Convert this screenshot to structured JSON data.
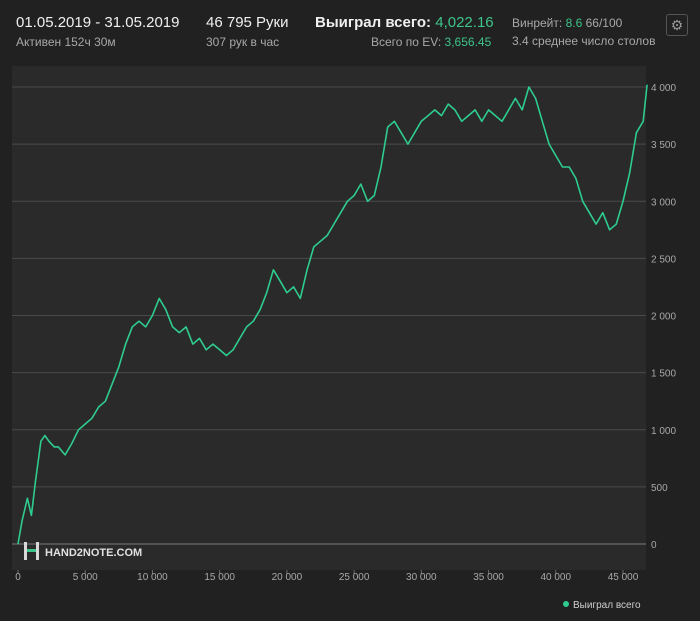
{
  "header": {
    "date_range": "01.05.2019 - 31.05.2019",
    "active": "Активен 152ч 30м",
    "hands": "46 795 Руки",
    "hands_per_hour": "307 рук в час",
    "won_label": "Выиграл всего:",
    "won_value": "4,022.16",
    "ev_label": "Всего по EV:",
    "ev_value": "3,656.45",
    "winrate_label": "Винрейт:",
    "winrate_value": "8.6",
    "winrate_suffix": "66/100",
    "tables": "3.4 среднее число столов"
  },
  "watermark": "HAND2NOTE.COM",
  "icons": {
    "settings": "gear-icon",
    "logo": "hand2note-logo-icon",
    "legend_dot": "dot-icon"
  },
  "colors": {
    "line": "#2ecc8f",
    "background": "#212121",
    "plot": "#2a2a2a",
    "accent": "#3ec48a"
  },
  "chart_data": {
    "type": "line",
    "title": "",
    "xlabel": "",
    "ylabel": "",
    "xlim": [
      0,
      46795
    ],
    "ylim": [
      -100,
      4100
    ],
    "x_ticks": [
      0,
      5000,
      10000,
      15000,
      20000,
      25000,
      30000,
      35000,
      40000,
      45000
    ],
    "x_tick_labels": [
      "0",
      "5 000",
      "10 000",
      "15 000",
      "20 000",
      "25 000",
      "30 000",
      "35 000",
      "40 000",
      "45 000"
    ],
    "y_ticks": [
      0,
      500,
      1000,
      1500,
      2000,
      2500,
      3000,
      3500,
      4000
    ],
    "y_tick_labels": [
      "0",
      "500",
      "1 000",
      "1 500",
      "2 000",
      "2 500",
      "3 000",
      "3 500",
      "4 000"
    ],
    "grid": true,
    "legend_position": "bottom-right",
    "series": [
      {
        "name": "Выиграл всего",
        "color": "#2ecc8f",
        "x": [
          0,
          300,
          700,
          1000,
          1300,
          1700,
          2000,
          2300,
          2700,
          3000,
          3500,
          4000,
          4500,
          5000,
          5500,
          6000,
          6500,
          7000,
          7500,
          8000,
          8500,
          9000,
          9500,
          10000,
          10500,
          11000,
          11500,
          12000,
          12500,
          13000,
          13500,
          14000,
          14500,
          15000,
          15500,
          16000,
          16500,
          17000,
          17500,
          18000,
          18500,
          19000,
          19500,
          20000,
          20500,
          21000,
          21500,
          22000,
          22500,
          23000,
          23500,
          24000,
          24500,
          25000,
          25500,
          26000,
          26500,
          27000,
          27500,
          28000,
          28500,
          29000,
          29500,
          30000,
          30500,
          31000,
          31500,
          32000,
          32500,
          33000,
          33500,
          34000,
          34500,
          35000,
          35500,
          36000,
          36500,
          37000,
          37500,
          38000,
          38500,
          39000,
          39500,
          40000,
          40500,
          41000,
          41500,
          42000,
          42500,
          43000,
          43500,
          44000,
          44500,
          45000,
          45500,
          46000,
          46500,
          46795
        ],
        "y": [
          0,
          200,
          400,
          250,
          550,
          900,
          950,
          900,
          850,
          850,
          780,
          880,
          1000,
          1050,
          1100,
          1200,
          1250,
          1400,
          1550,
          1750,
          1900,
          1950,
          1900,
          2000,
          2150,
          2050,
          1900,
          1850,
          1900,
          1750,
          1800,
          1700,
          1750,
          1700,
          1650,
          1700,
          1800,
          1900,
          1950,
          2050,
          2200,
          2400,
          2300,
          2200,
          2250,
          2150,
          2400,
          2600,
          2650,
          2700,
          2800,
          2900,
          3000,
          3050,
          3150,
          3000,
          3050,
          3300,
          3650,
          3700,
          3600,
          3500,
          3600,
          3700,
          3750,
          3800,
          3750,
          3850,
          3800,
          3700,
          3750,
          3800,
          3700,
          3800,
          3750,
          3700,
          3800,
          3900,
          3800,
          4000,
          3900,
          3700,
          3500,
          3400,
          3300,
          3300,
          3200,
          3000,
          2900,
          2800,
          2900,
          2750,
          2800,
          3000,
          3250,
          3600,
          3700,
          4020
        ]
      }
    ]
  }
}
